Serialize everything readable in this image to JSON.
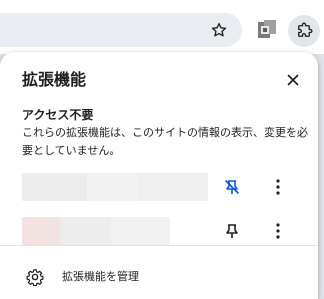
{
  "popup": {
    "title": "拡張機能",
    "section_heading": "アクセス不要",
    "section_description": "これらの拡張機能は、このサイトの情報の表示、変更を必要としていません。",
    "manage_label": "拡張機能を管理"
  },
  "extensions": [
    {
      "pinned": true,
      "pin_icon": "pin-off-icon"
    },
    {
      "pinned": false,
      "pin_icon": "pin-icon"
    }
  ],
  "colors": {
    "accent_blue": "#0b57d0",
    "text": "#1f1f1f",
    "icon_gray": "#444746"
  }
}
